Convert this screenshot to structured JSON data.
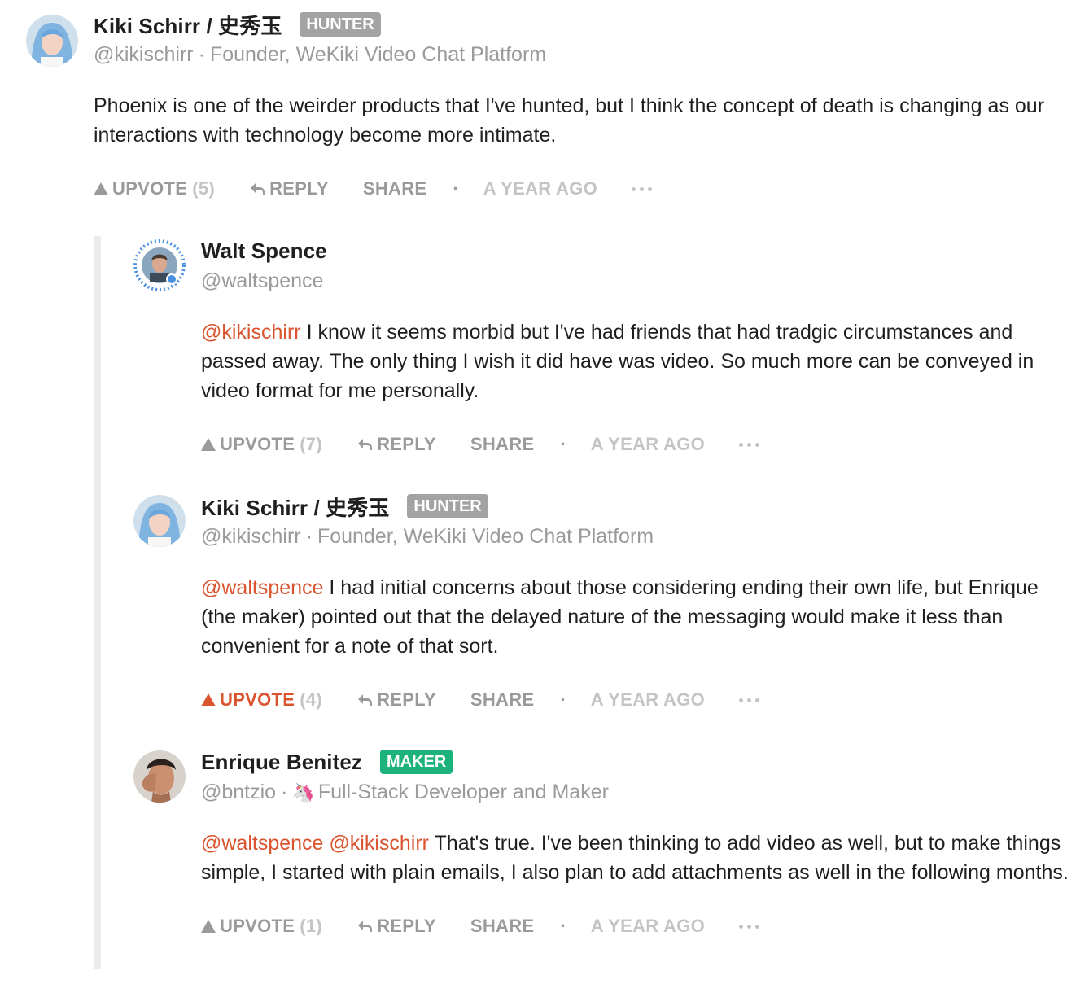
{
  "comments": [
    {
      "author": "Kiki Schirr / 史秀玉",
      "badge": "HUNTER",
      "handle": "@kikischirr",
      "headline": "Founder, WeKiki Video Chat Platform",
      "mentions": [],
      "text": "Phoenix is one of the weirder products that I've hunted, but I think the concept of death is changing as our interactions with technology become more intimate.",
      "upvote_label": "UPVOTE",
      "upvotes": "(5)",
      "reply_label": "REPLY",
      "share_label": "SHARE",
      "time": "A YEAR AGO"
    },
    {
      "author": "Walt Spence",
      "badge": "",
      "handle": "@waltspence",
      "headline": "",
      "mentions": [
        "@kikischirr"
      ],
      "text": "I know it seems morbid but I've had friends that had tradgic circumstances and passed away. The only thing I wish it did have was video. So much more can be conveyed in video format for me personally.",
      "upvote_label": "UPVOTE",
      "upvotes": "(7)",
      "reply_label": "REPLY",
      "share_label": "SHARE",
      "time": "A YEAR AGO"
    },
    {
      "author": "Kiki Schirr / 史秀玉",
      "badge": "HUNTER",
      "handle": "@kikischirr",
      "headline": "Founder, WeKiki Video Chat Platform",
      "mentions": [
        "@waltspence"
      ],
      "text": "I had initial concerns about those considering ending their own life, but Enrique (the maker) pointed out that the delayed nature of the messaging would make it less than convenient for a note of that sort.",
      "upvote_label": "UPVOTE",
      "upvotes": "(4)",
      "reply_label": "REPLY",
      "share_label": "SHARE",
      "time": "A YEAR AGO"
    },
    {
      "author": "Enrique Benitez",
      "badge": "MAKER",
      "handle": "@bntzio",
      "headline": "Full-Stack Developer and Maker",
      "headline_icon": "unicorn-icon",
      "mentions": [
        "@waltspence",
        "@kikischirr"
      ],
      "text": "That's true. I've been thinking to add video as well, but to make things simple, I started with plain emails, I also plan to add attachments as well in the following months.",
      "upvote_label": "UPVOTE",
      "upvotes": "(1)",
      "reply_label": "REPLY",
      "share_label": "SHARE",
      "time": "A YEAR AGO"
    }
  ],
  "colors": {
    "accent": "#da552f",
    "hunter_badge": "#a3a3a3",
    "maker_badge": "#1bb27c",
    "muted": "#9a9a9a"
  }
}
